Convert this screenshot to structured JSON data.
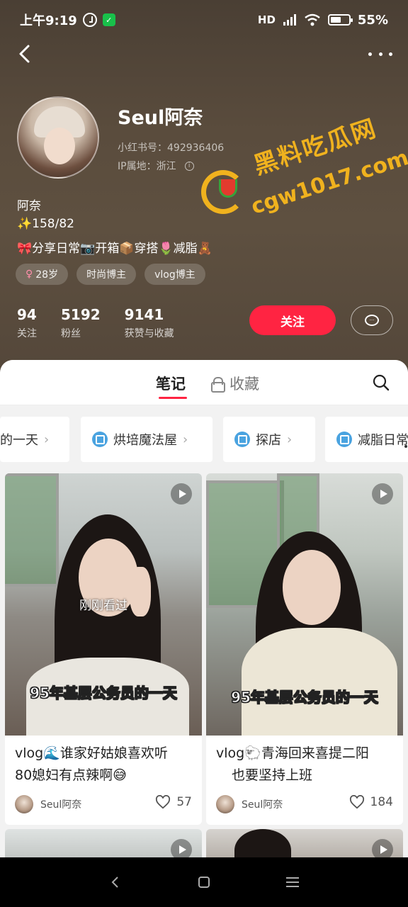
{
  "status_bar": {
    "time": "上午9:19",
    "wechat_glyph": "✓",
    "network": "HD",
    "battery": "55%"
  },
  "profile": {
    "name": "Seul阿奈",
    "red_id": "小红书号：492936406",
    "ip": "IP属地：浙江",
    "nickname": "阿奈",
    "body_stats": "✨158/82",
    "bio": "🎀分享日常📷开箱📦穿搭🌷减脂🧸",
    "tags": [
      {
        "label": "28岁",
        "icon": "♀"
      },
      {
        "label": "时尚博主"
      },
      {
        "label": "vlog博主"
      }
    ],
    "stats": [
      {
        "value": "94",
        "label": "关注"
      },
      {
        "value": "5192",
        "label": "粉丝"
      },
      {
        "value": "9141",
        "label": "获赞与收藏"
      }
    ],
    "follow_label": "关注",
    "message_glyph": "···"
  },
  "watermark": {
    "line1": "黑料吃瓜网",
    "line2": "cgw1017.com"
  },
  "tabs": {
    "notes": "笔记",
    "favorites": "收藏"
  },
  "collections": [
    {
      "label": "的一天"
    },
    {
      "label": "烘培魔法屋"
    },
    {
      "label": "探店"
    },
    {
      "label": "减脂日常"
    }
  ],
  "chevron": "›",
  "posts": [
    {
      "overlay": "95年基层公务员的一天",
      "recent": "刚刚看过",
      "title_line1": "vlog🌊谁家好姑娘喜欢听",
      "title_line2": "80媳妇有点辣啊😅",
      "author": "Seul阿奈",
      "likes": "57"
    },
    {
      "overlay": "95年基层公务员的一天",
      "title_line1": "vlog🐑青海回来喜提二阳",
      "title_line2": "也要坚持上班",
      "author": "Seul阿奈",
      "likes": "184"
    }
  ]
}
